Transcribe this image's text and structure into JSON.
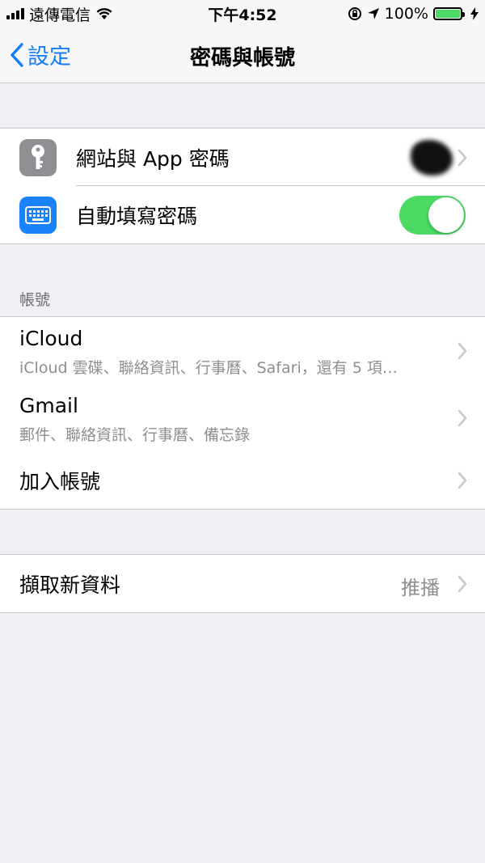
{
  "status": {
    "carrier": "遠傳電信",
    "time": "下午4:52",
    "battery": "100%"
  },
  "nav": {
    "back_label": "設定",
    "title": "密碼與帳號"
  },
  "passwords": {
    "website_passwords": "網站與 App 密碼",
    "autofill": "自動填寫密碼",
    "autofill_on": true
  },
  "accounts": {
    "header": "帳號",
    "items": [
      {
        "title": "iCloud",
        "subtitle": "iCloud 雲碟、聯絡資訊、行事曆、Safari，還有 5 項…"
      },
      {
        "title": "Gmail",
        "subtitle": "郵件、聯絡資訊、行事曆、備忘錄"
      }
    ],
    "add_account": "加入帳號"
  },
  "fetch": {
    "label": "擷取新資料",
    "value": "推播"
  },
  "colors": {
    "accent": "#147efb",
    "toggle_on": "#4cd964",
    "key_icon_bg": "#8e8e93",
    "keyboard_icon_bg": "#1a82fb"
  }
}
